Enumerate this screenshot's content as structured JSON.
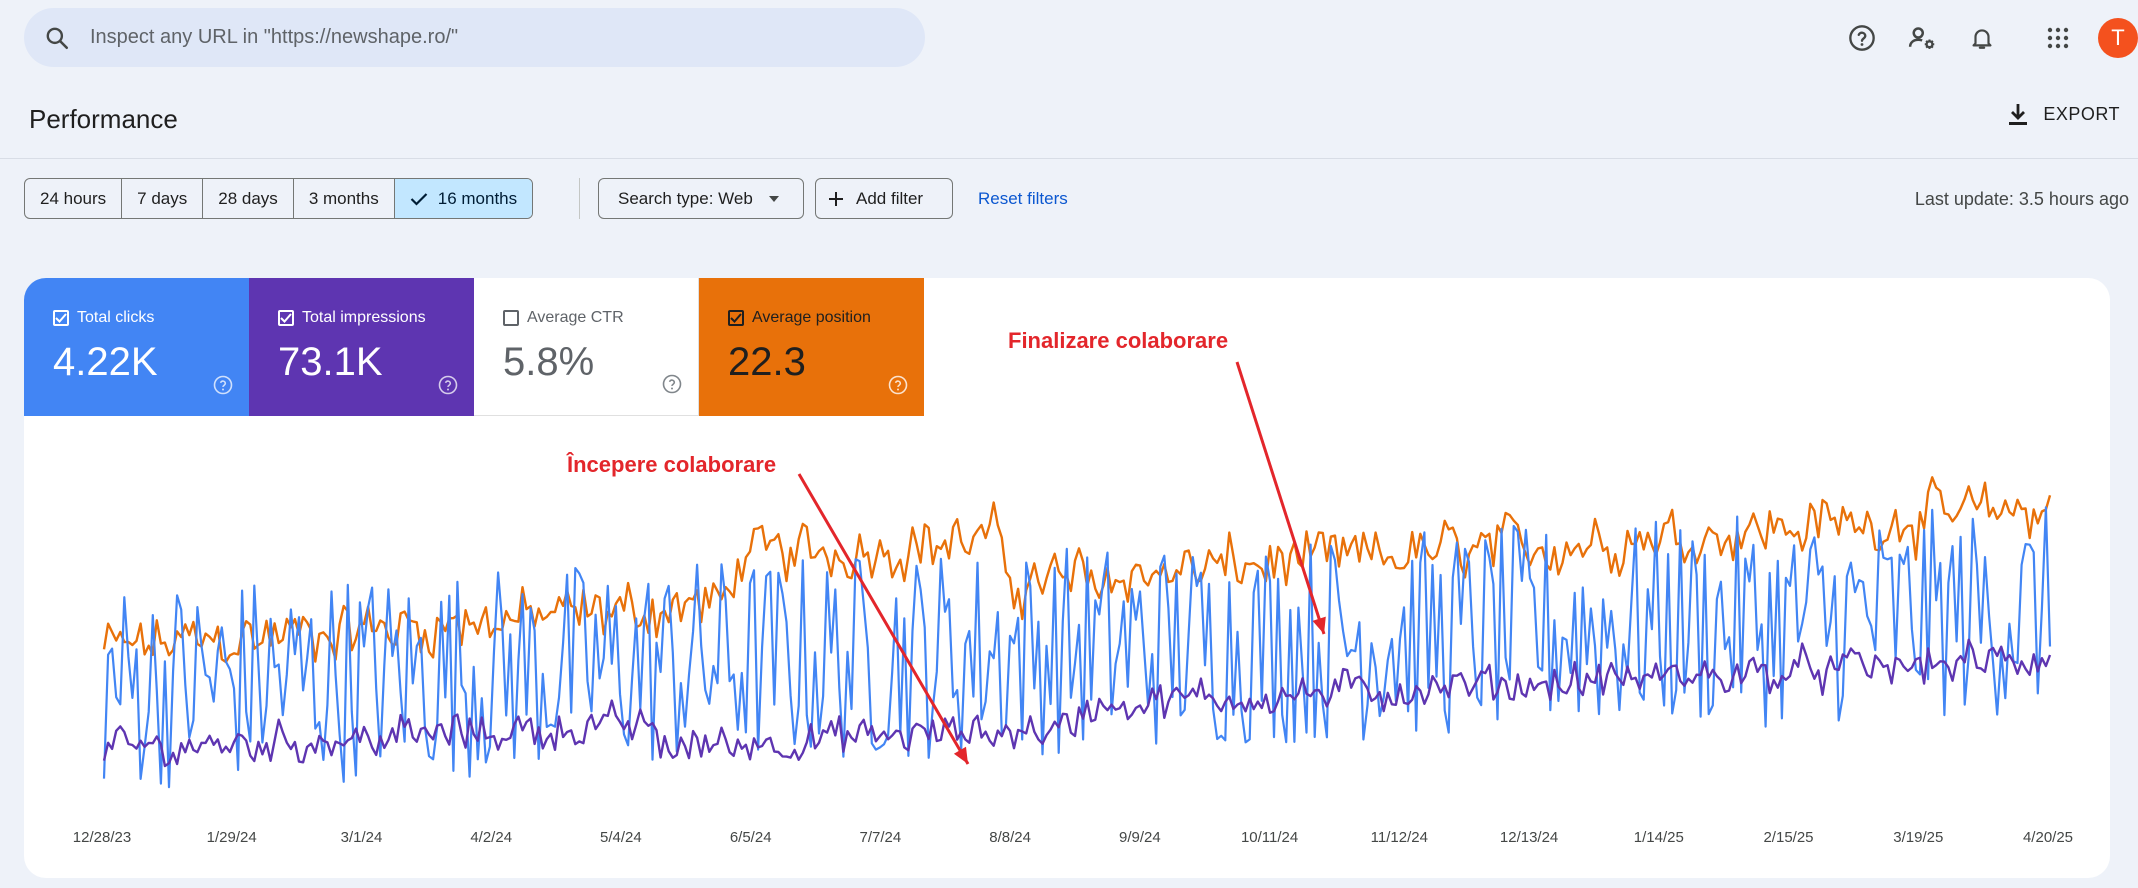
{
  "search": {
    "placeholder": "Inspect any URL in \"https://newshape.ro/\""
  },
  "user": {
    "avatar_letter": "T",
    "avatar_color": "#f4511e"
  },
  "header": {
    "title": "Performance",
    "export_label": "EXPORT"
  },
  "filters": {
    "ranges": [
      {
        "label": "24 hours",
        "active": false
      },
      {
        "label": "7 days",
        "active": false
      },
      {
        "label": "28 days",
        "active": false
      },
      {
        "label": "3 months",
        "active": false
      },
      {
        "label": "16 months",
        "active": true
      }
    ],
    "search_type": "Search type: Web",
    "add_filter": "Add filter",
    "reset": "Reset filters",
    "last_update": "Last update: 3.5 hours ago"
  },
  "metrics": [
    {
      "label": "Total clicks",
      "value": "4.22K",
      "checked": true,
      "color": "#4285f4"
    },
    {
      "label": "Total impressions",
      "value": "73.1K",
      "checked": true,
      "color": "#5e35b1"
    },
    {
      "label": "Average CTR",
      "value": "5.8%",
      "checked": false,
      "color": "#ffffff"
    },
    {
      "label": "Average position",
      "value": "22.3",
      "checked": true,
      "color": "#e8710a"
    }
  ],
  "annotations": {
    "start": "Începere colaborare",
    "end": "Finalizare colaborare"
  },
  "chart_data": {
    "type": "line",
    "x_tick_labels": [
      "12/28/23",
      "1/29/24",
      "3/1/24",
      "4/2/24",
      "5/4/24",
      "6/5/24",
      "7/7/24",
      "8/8/24",
      "9/9/24",
      "10/11/24",
      "11/12/24",
      "12/13/24",
      "1/14/25",
      "2/15/25",
      "3/19/25",
      "4/20/25"
    ],
    "grid": false,
    "series": [
      {
        "name": "Total clicks",
        "color": "#4285f4",
        "samples": 480,
        "mean_start": 0.35,
        "mean_end": 0.55,
        "noise": 0.28
      },
      {
        "name": "Total impressions",
        "color": "#5e35b1",
        "samples": 480,
        "mean_start": 0.18,
        "mean_end": 0.42,
        "noise": 0.06
      },
      {
        "name": "Average position",
        "color": "#e8710a",
        "samples": 480,
        "mean_start": 0.45,
        "mean_end": 0.82,
        "noise": 0.09
      }
    ]
  }
}
